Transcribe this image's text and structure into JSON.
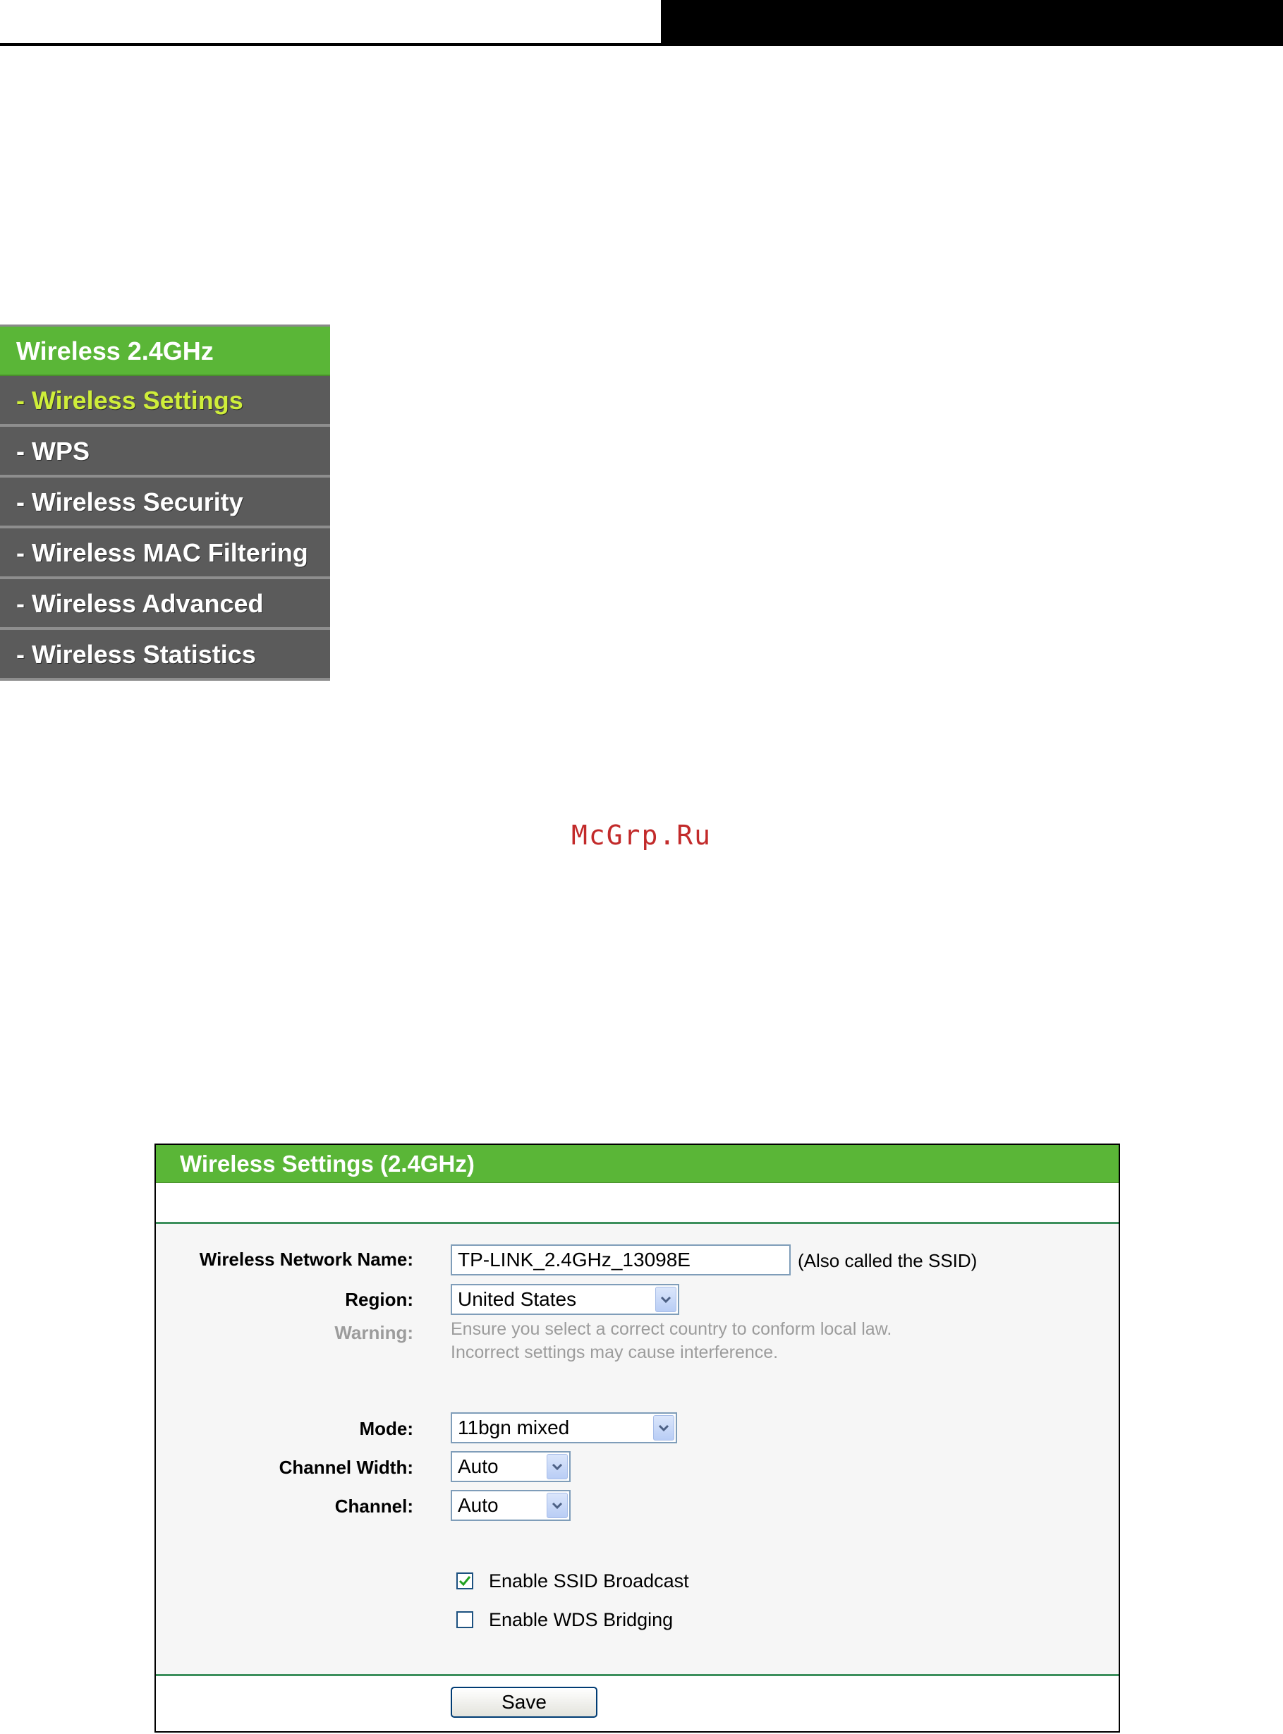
{
  "menu": {
    "title": "Wireless 2.4GHz",
    "items": [
      {
        "label": "- Wireless Settings",
        "active": true
      },
      {
        "label": "- WPS"
      },
      {
        "label": "- Wireless Security"
      },
      {
        "label": "- Wireless MAC Filtering"
      },
      {
        "label": "- Wireless Advanced"
      },
      {
        "label": "- Wireless Statistics"
      }
    ]
  },
  "watermark": "McGrp.Ru",
  "panel": {
    "title": "Wireless Settings (2.4GHz)",
    "network_name": {
      "label": "Wireless Network Name:",
      "value": "TP-LINK_2.4GHz_13098E",
      "note": "(Also called the SSID)"
    },
    "region": {
      "label": "Region:",
      "value": "United States"
    },
    "warning": {
      "label": "Warning:",
      "line1": "Ensure you select a correct country to conform local law.",
      "line2": "Incorrect settings may cause interference."
    },
    "mode": {
      "label": "Mode:",
      "value": "11bgn mixed"
    },
    "channel_width": {
      "label": "Channel Width:",
      "value": "Auto"
    },
    "channel": {
      "label": "Channel:",
      "value": "Auto"
    },
    "ssid_broadcast": {
      "label": "Enable SSID Broadcast",
      "checked": true
    },
    "wds_bridging": {
      "label": "Enable WDS Bridging",
      "checked": false
    },
    "save_label": "Save"
  },
  "colors": {
    "accent_green": "#5ab637",
    "menu_gray": "#5b5b5b",
    "active_text": "#cfee3a"
  }
}
